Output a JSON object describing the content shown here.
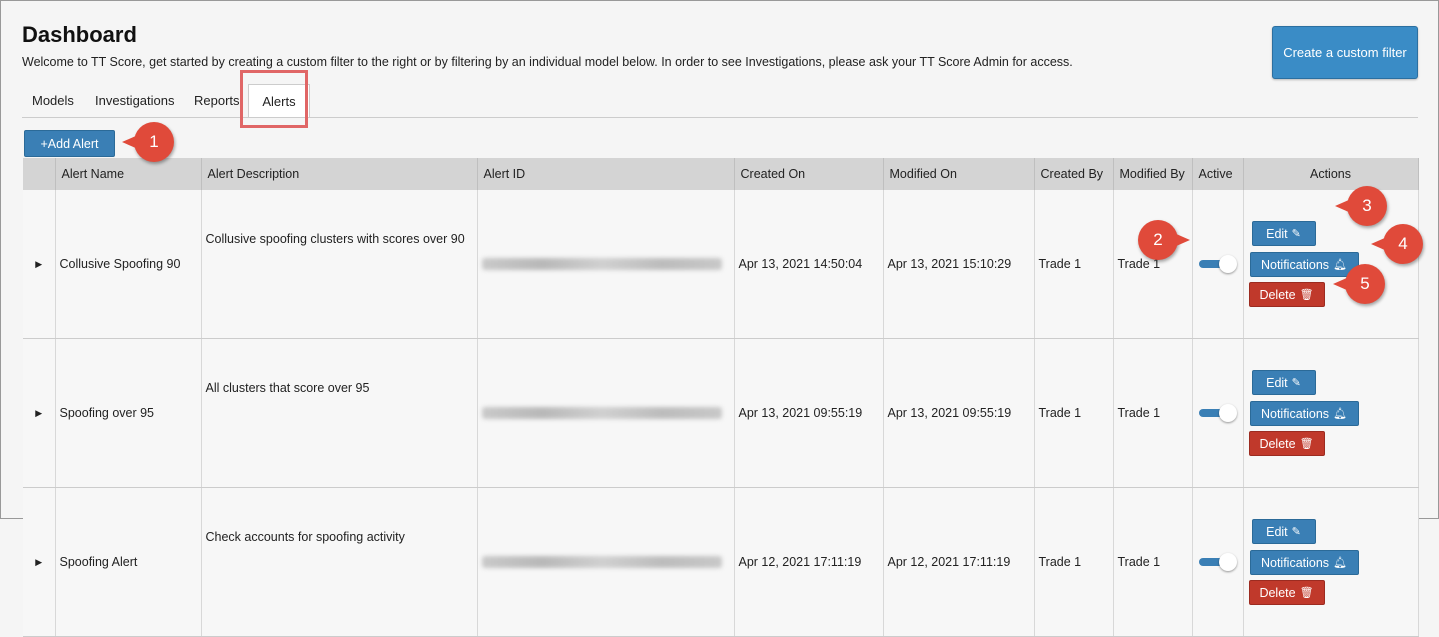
{
  "header": {
    "title": "Dashboard",
    "subtitle": "Welcome to TT Score, get started by creating a custom filter to the right or by filtering by an individual model below. In order to see Investigations, please ask your TT Score Admin for access.",
    "create_filter_label": "Create a custom filter"
  },
  "tabs": [
    {
      "label": "Models"
    },
    {
      "label": "Investigations"
    },
    {
      "label": "Reports"
    },
    {
      "label": "Alerts",
      "active": true
    }
  ],
  "add_alert_label": "+Add Alert",
  "table": {
    "columns": [
      "",
      "Alert Name",
      "Alert Description",
      "Alert ID",
      "Created On",
      "Modified On",
      "Created By",
      "Modified By",
      "Active",
      "Actions"
    ],
    "rows": [
      {
        "name": "Collusive Spoofing 90",
        "description": "Collusive spoofing clusters with scores over 90",
        "created_on": "Apr 13, 2021 14:50:04",
        "modified_on": "Apr 13, 2021 15:10:29",
        "created_by": "Trade 1",
        "modified_by": "Trade 1",
        "active": true
      },
      {
        "name": "Spoofing over 95",
        "description": "All clusters that score over 95",
        "created_on": "Apr 13, 2021 09:55:19",
        "modified_on": "Apr 13, 2021 09:55:19",
        "created_by": "Trade 1",
        "modified_by": "Trade 1",
        "active": true
      },
      {
        "name": "Spoofing Alert",
        "description": "Check accounts for spoofing activity",
        "created_on": "Apr 12, 2021 17:11:19",
        "modified_on": "Apr 12, 2021 17:11:19",
        "created_by": "Trade 1",
        "modified_by": "Trade 1",
        "active": true
      }
    ],
    "actions": {
      "edit": "Edit",
      "notifications": "Notifications",
      "delete": "Delete"
    }
  },
  "callouts": [
    "1",
    "2",
    "3",
    "4",
    "5"
  ],
  "colors": {
    "primary": "#3a7fb5",
    "danger": "#c0392b",
    "callout": "#e04a3a",
    "highlight": "#e06666"
  },
  "icons": {
    "caret": "caret-right-icon",
    "edit": "edit-icon",
    "notifications": "bell-icon",
    "delete": "trash-icon"
  }
}
